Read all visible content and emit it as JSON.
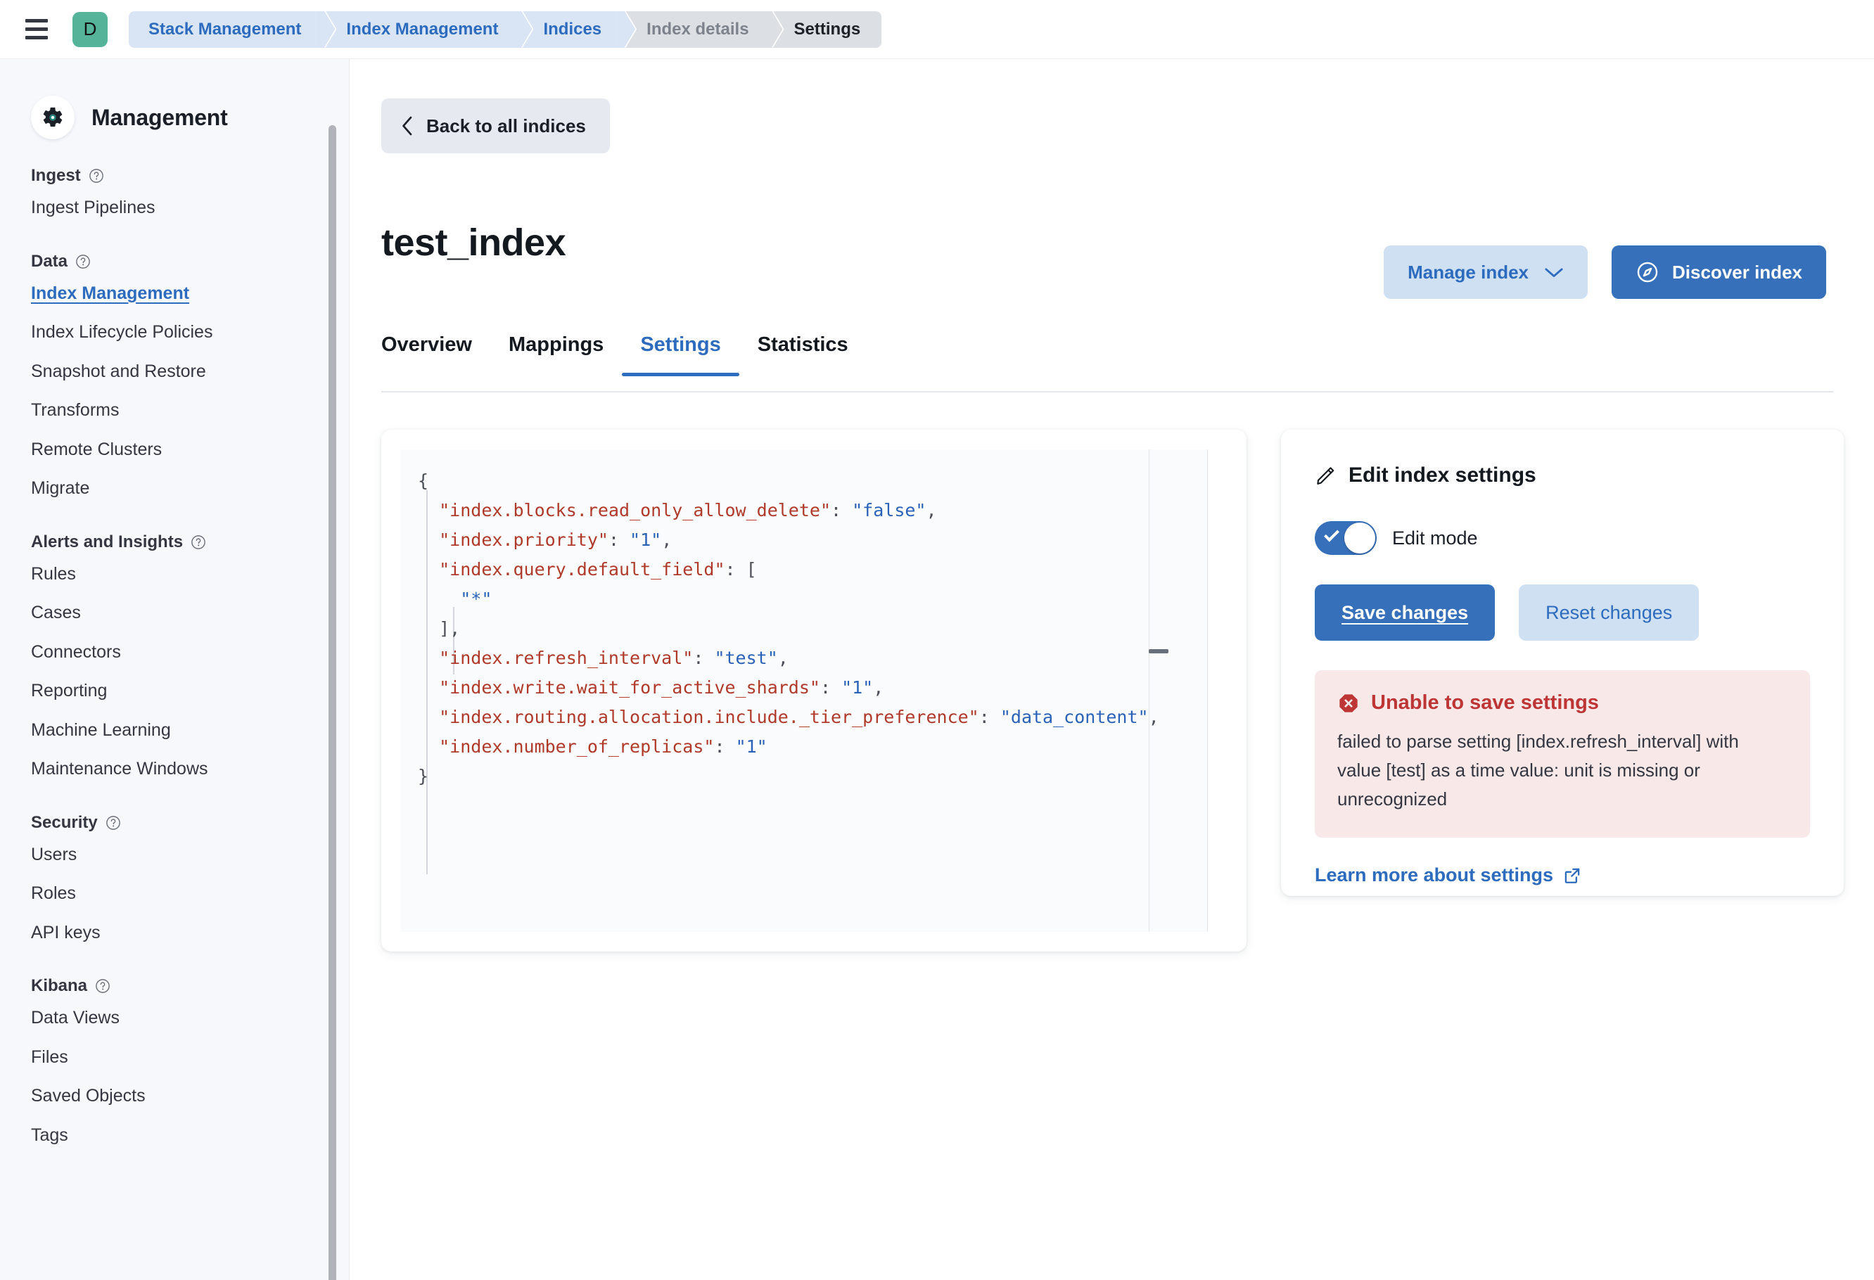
{
  "topbar": {
    "menu_icon": "hamburger-menu-icon",
    "avatar_label": "D",
    "breadcrumbs": [
      {
        "label": "Stack Management",
        "state": "link"
      },
      {
        "label": "Index Management",
        "state": "link"
      },
      {
        "label": "Indices",
        "state": "link"
      },
      {
        "label": "Index details",
        "state": "muted"
      },
      {
        "label": "Settings",
        "state": "current"
      }
    ]
  },
  "sidebar": {
    "app_icon": "gear-icon",
    "title": "Management",
    "sections": [
      {
        "title": "Ingest",
        "help_icon": "question-circle-icon",
        "items": [
          {
            "label": "Ingest Pipelines",
            "active": false
          }
        ]
      },
      {
        "title": "Data",
        "help_icon": "question-circle-icon",
        "items": [
          {
            "label": "Index Management",
            "active": true
          },
          {
            "label": "Index Lifecycle Policies",
            "active": false
          },
          {
            "label": "Snapshot and Restore",
            "active": false
          },
          {
            "label": "Transforms",
            "active": false
          },
          {
            "label": "Remote Clusters",
            "active": false
          },
          {
            "label": "Migrate",
            "active": false
          }
        ]
      },
      {
        "title": "Alerts and Insights",
        "help_icon": "question-circle-icon",
        "items": [
          {
            "label": "Rules",
            "active": false
          },
          {
            "label": "Cases",
            "active": false
          },
          {
            "label": "Connectors",
            "active": false
          },
          {
            "label": "Reporting",
            "active": false
          },
          {
            "label": "Machine Learning",
            "active": false
          },
          {
            "label": "Maintenance Windows",
            "active": false
          }
        ]
      },
      {
        "title": "Security",
        "help_icon": "question-circle-icon",
        "items": [
          {
            "label": "Users",
            "active": false
          },
          {
            "label": "Roles",
            "active": false
          },
          {
            "label": "API keys",
            "active": false
          }
        ]
      },
      {
        "title": "Kibana",
        "help_icon": "question-circle-icon",
        "items": [
          {
            "label": "Data Views",
            "active": false
          },
          {
            "label": "Files",
            "active": false
          },
          {
            "label": "Saved Objects",
            "active": false
          },
          {
            "label": "Tags",
            "active": false
          }
        ]
      }
    ]
  },
  "main": {
    "back_button": {
      "label": "Back to all indices",
      "icon": "chevron-left-icon"
    },
    "page_title": "test_index",
    "manage_button": {
      "label": "Manage index",
      "icon": "chevron-down-icon"
    },
    "discover_button": {
      "label": "Discover index",
      "icon": "compass-icon"
    },
    "tabs": [
      {
        "label": "Overview",
        "active": false
      },
      {
        "label": "Mappings",
        "active": false
      },
      {
        "label": "Settings",
        "active": true
      },
      {
        "label": "Statistics",
        "active": false
      }
    ]
  },
  "editor": {
    "lines": [
      {
        "indent": 0,
        "parts": [
          {
            "t": "{",
            "c": "punc"
          }
        ]
      },
      {
        "indent": 1,
        "parts": [
          {
            "t": "\"index.blocks.read_only_allow_delete\"",
            "c": "key"
          },
          {
            "t": ": ",
            "c": "punc"
          },
          {
            "t": "\"false\"",
            "c": "val"
          },
          {
            "t": ",",
            "c": "punc"
          }
        ]
      },
      {
        "indent": 1,
        "parts": [
          {
            "t": "\"index.priority\"",
            "c": "key"
          },
          {
            "t": ": ",
            "c": "punc"
          },
          {
            "t": "\"1\"",
            "c": "val"
          },
          {
            "t": ",",
            "c": "punc"
          }
        ]
      },
      {
        "indent": 1,
        "parts": [
          {
            "t": "\"index.query.default_field\"",
            "c": "key"
          },
          {
            "t": ": [",
            "c": "punc"
          }
        ]
      },
      {
        "indent": 2,
        "parts": [
          {
            "t": "\"*\"",
            "c": "val"
          }
        ]
      },
      {
        "indent": 1,
        "parts": [
          {
            "t": "],",
            "c": "punc"
          }
        ]
      },
      {
        "indent": 1,
        "parts": [
          {
            "t": "\"index.refresh_interval\"",
            "c": "key"
          },
          {
            "t": ": ",
            "c": "punc"
          },
          {
            "t": "\"test\"",
            "c": "val"
          },
          {
            "t": ",",
            "c": "punc"
          }
        ]
      },
      {
        "indent": 1,
        "parts": [
          {
            "t": "\"index.write.wait_for_active_shards\"",
            "c": "key"
          },
          {
            "t": ": ",
            "c": "punc"
          },
          {
            "t": "\"1\"",
            "c": "val"
          },
          {
            "t": ",",
            "c": "punc"
          }
        ]
      },
      {
        "indent": 1,
        "parts": [
          {
            "t": "\"index.routing.allocation.include._tier_preference\"",
            "c": "key"
          },
          {
            "t": ": ",
            "c": "punc"
          },
          {
            "t": "\"data_content\"",
            "c": "val"
          },
          {
            "t": ",",
            "c": "punc"
          }
        ]
      },
      {
        "indent": 1,
        "parts": [
          {
            "t": "\"index.number_of_replicas\"",
            "c": "key"
          },
          {
            "t": ": ",
            "c": "punc"
          },
          {
            "t": "\"1\"",
            "c": "val"
          }
        ]
      },
      {
        "indent": 0,
        "parts": [
          {
            "t": "}",
            "c": "punc"
          }
        ]
      }
    ]
  },
  "side_panel": {
    "title": "Edit index settings",
    "title_icon": "pencil-icon",
    "toggle": {
      "label": "Edit mode",
      "on": true
    },
    "save_label": "Save changes",
    "reset_label": "Reset changes",
    "callout": {
      "icon": "error-octagon-icon",
      "title": "Unable to save settings",
      "body": "failed to parse setting [index.refresh_interval] with value [test] as a time value: unit is missing or unrecognized"
    },
    "learn_link": {
      "label": "Learn more about settings",
      "icon": "external-link-icon"
    }
  },
  "colors": {
    "accent_blue": "#3670bb",
    "link_blue": "#2c6bbd",
    "avatar_teal": "#54b399",
    "error_red": "#bd3535",
    "error_bg": "#f8e8e8",
    "code_key": "#b03a2a",
    "code_value": "#2a62b8",
    "sidebar_bg": "#f7f8fc"
  }
}
